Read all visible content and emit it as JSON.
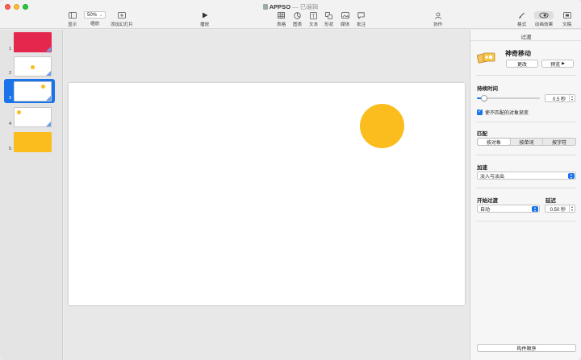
{
  "window": {
    "doc_name": "APPSO",
    "separator": "—",
    "doc_status": "已编辑"
  },
  "toolbar": {
    "view_label": "显示",
    "zoom_value": "50%",
    "zoom_label": "缩放",
    "add_slide_label": "添加幻灯片",
    "play_label": "播放",
    "table_label": "表格",
    "chart_label": "图表",
    "text_label": "文本",
    "shape_label": "形状",
    "media_label": "媒体",
    "comment_label": "批注",
    "collaborate_label": "协作",
    "format_label": "格式",
    "animate_label": "动画效果",
    "document_label": "文稿"
  },
  "slides": [
    {
      "number": "1",
      "bg": "#e5264d",
      "has_dot": false,
      "selected": false
    },
    {
      "number": "2",
      "bg": "#ffffff",
      "has_dot": true,
      "selected": false
    },
    {
      "number": "3",
      "bg": "#ffffff",
      "has_dot": true,
      "selected": true
    },
    {
      "number": "4",
      "bg": "#ffffff",
      "has_dot": true,
      "selected": false
    },
    {
      "number": "5",
      "bg": "#fbbd1e",
      "has_dot": false,
      "selected": false
    }
  ],
  "colors": {
    "accent": "#1a73e8",
    "circle": "#fbbd1e",
    "red_slide": "#e5264d"
  },
  "inspector": {
    "tab_title": "过渡",
    "transition_name": "神奇移动",
    "change_button": "更改",
    "preview_button": "预览",
    "preview_icon": "play-icon",
    "duration_label": "持续时间",
    "duration_value": "0.5 秒",
    "duration_fraction": 0.12,
    "fade_checkbox_label": "使不匹配的对象渐变",
    "fade_checked": true,
    "match_label": "匹配",
    "match_options": [
      "按对象",
      "按单词",
      "按字符"
    ],
    "match_selected": "按对象",
    "accel_label": "加速",
    "accel_value": "淡入与淡出",
    "start_label": "开始过渡",
    "start_value": "自动",
    "delay_label": "延迟",
    "delay_value": "0.50 秒",
    "build_order_button": "构件顺序"
  }
}
